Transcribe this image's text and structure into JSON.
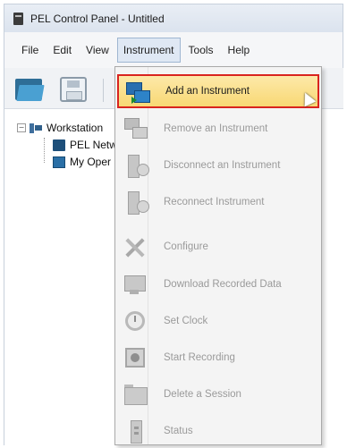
{
  "window": {
    "title": "PEL Control Panel - Untitled"
  },
  "menubar": {
    "items": [
      "File",
      "Edit",
      "View",
      "Instrument",
      "Tools",
      "Help"
    ],
    "active": "Instrument"
  },
  "tree": {
    "root": "Workstation",
    "children": [
      "PEL Netw",
      "My Oper"
    ]
  },
  "instrument_menu": {
    "items": [
      {
        "label": "Add an Instrument",
        "enabled": true,
        "highlighted": true,
        "icon": "add-instrument-icon"
      },
      {
        "label": "Remove an Instrument",
        "enabled": false,
        "icon": "remove-instrument-icon"
      },
      {
        "label": "Disconnect an Instrument",
        "enabled": false,
        "icon": "disconnect-instrument-icon"
      },
      {
        "label": "Reconnect Instrument",
        "enabled": false,
        "icon": "reconnect-instrument-icon"
      },
      {
        "label": "Configure",
        "enabled": false,
        "icon": "configure-icon"
      },
      {
        "label": "Download Recorded Data",
        "enabled": false,
        "icon": "download-data-icon"
      },
      {
        "label": "Set Clock",
        "enabled": false,
        "icon": "clock-icon"
      },
      {
        "label": "Start Recording",
        "enabled": false,
        "icon": "record-icon"
      },
      {
        "label": "Delete a Session",
        "enabled": false,
        "icon": "delete-session-icon"
      },
      {
        "label": "Status",
        "enabled": false,
        "icon": "status-icon"
      }
    ]
  },
  "colors": {
    "highlight_border": "#d9241f",
    "highlight_fill": "#f8d874",
    "disabled_text": "#9a9a9a"
  }
}
